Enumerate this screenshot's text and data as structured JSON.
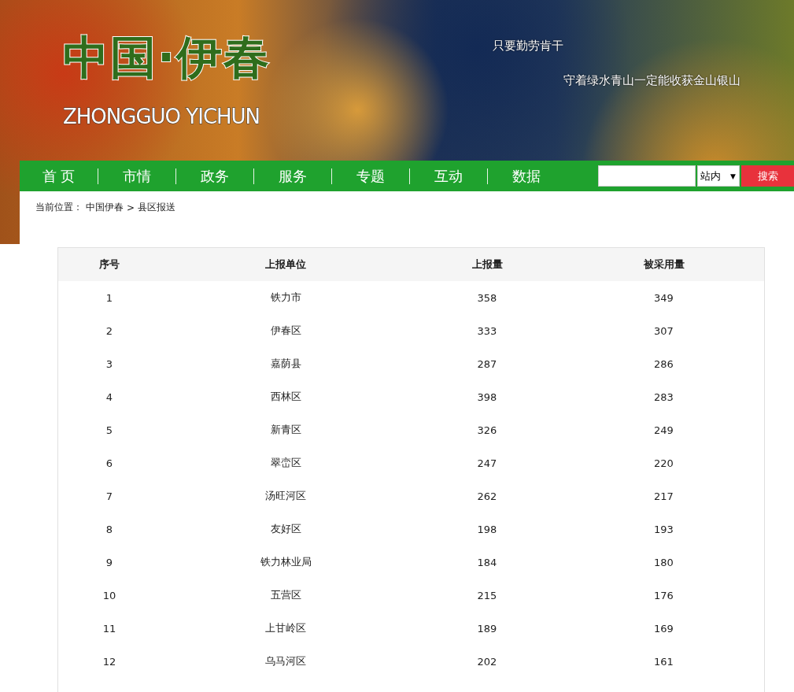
{
  "header": {
    "logo_title": "中国·伊春",
    "logo_subtitle": "ZHONGGUO YICHUN",
    "slogans": [
      "只要勤劳肯干",
      "守着绿水青山一定能收获金山银山"
    ]
  },
  "nav": {
    "items": [
      {
        "label": "首 页"
      },
      {
        "label": "市情"
      },
      {
        "label": "政务"
      },
      {
        "label": "服务"
      },
      {
        "label": "专题"
      },
      {
        "label": "互动"
      },
      {
        "label": "数据"
      }
    ],
    "search": {
      "scope": "站内",
      "scope_arrow": "▼",
      "button": "搜索"
    }
  },
  "breadcrumb": {
    "label": "当前位置：",
    "separator": ">",
    "items": [
      "中国伊春",
      "县区报送"
    ]
  },
  "table": {
    "columns": [
      "序号",
      "上报单位",
      "上报量",
      "被采用量"
    ],
    "rows": [
      [
        "1",
        "铁力市",
        "358",
        "349"
      ],
      [
        "2",
        "伊春区",
        "333",
        "307"
      ],
      [
        "3",
        "嘉荫县",
        "287",
        "286"
      ],
      [
        "4",
        "西林区",
        "398",
        "283"
      ],
      [
        "5",
        "新青区",
        "326",
        "249"
      ],
      [
        "6",
        "翠峦区",
        "247",
        "220"
      ],
      [
        "7",
        "汤旺河区",
        "262",
        "217"
      ],
      [
        "8",
        "友好区",
        "198",
        "193"
      ],
      [
        "9",
        "铁力林业局",
        "184",
        "180"
      ],
      [
        "10",
        "五营区",
        "215",
        "176"
      ],
      [
        "11",
        "上甘岭区",
        "189",
        "169"
      ],
      [
        "12",
        "乌马河区",
        "202",
        "161"
      ]
    ]
  }
}
